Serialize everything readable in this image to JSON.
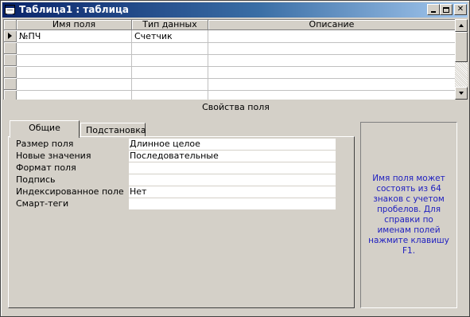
{
  "window": {
    "title": "Таблица1 : таблица",
    "controls": {
      "minimize": "minimize",
      "maximize": "maximize",
      "close": "✕"
    }
  },
  "grid": {
    "columns": [
      "Имя поля",
      "Тип данных",
      "Описание"
    ],
    "rows": [
      {
        "field_name": "№ПЧ",
        "data_type": "Счетчик",
        "description": ""
      }
    ]
  },
  "field_properties": {
    "section_title": "Свойства поля",
    "tabs": [
      {
        "label": "Общие",
        "active": true
      },
      {
        "label": "Подстановка",
        "active": false
      }
    ],
    "properties": [
      {
        "label": "Размер поля",
        "value": "Длинное целое"
      },
      {
        "label": "Новые значения",
        "value": "Последовательные"
      },
      {
        "label": "Формат поля",
        "value": ""
      },
      {
        "label": "Подпись",
        "value": ""
      },
      {
        "label": "Индексированное поле",
        "value": "Нет"
      },
      {
        "label": "Смарт-теги",
        "value": ""
      }
    ],
    "help_text": "Имя поля может состоять из 64 знаков с учетом пробелов.  Для справки по именам полей нажмите клавишу F1.",
    "help_color": "#2020c0"
  },
  "colors": {
    "title_start": "#0a246a",
    "title_end": "#a6caf0",
    "face": "#d4d0c8"
  }
}
